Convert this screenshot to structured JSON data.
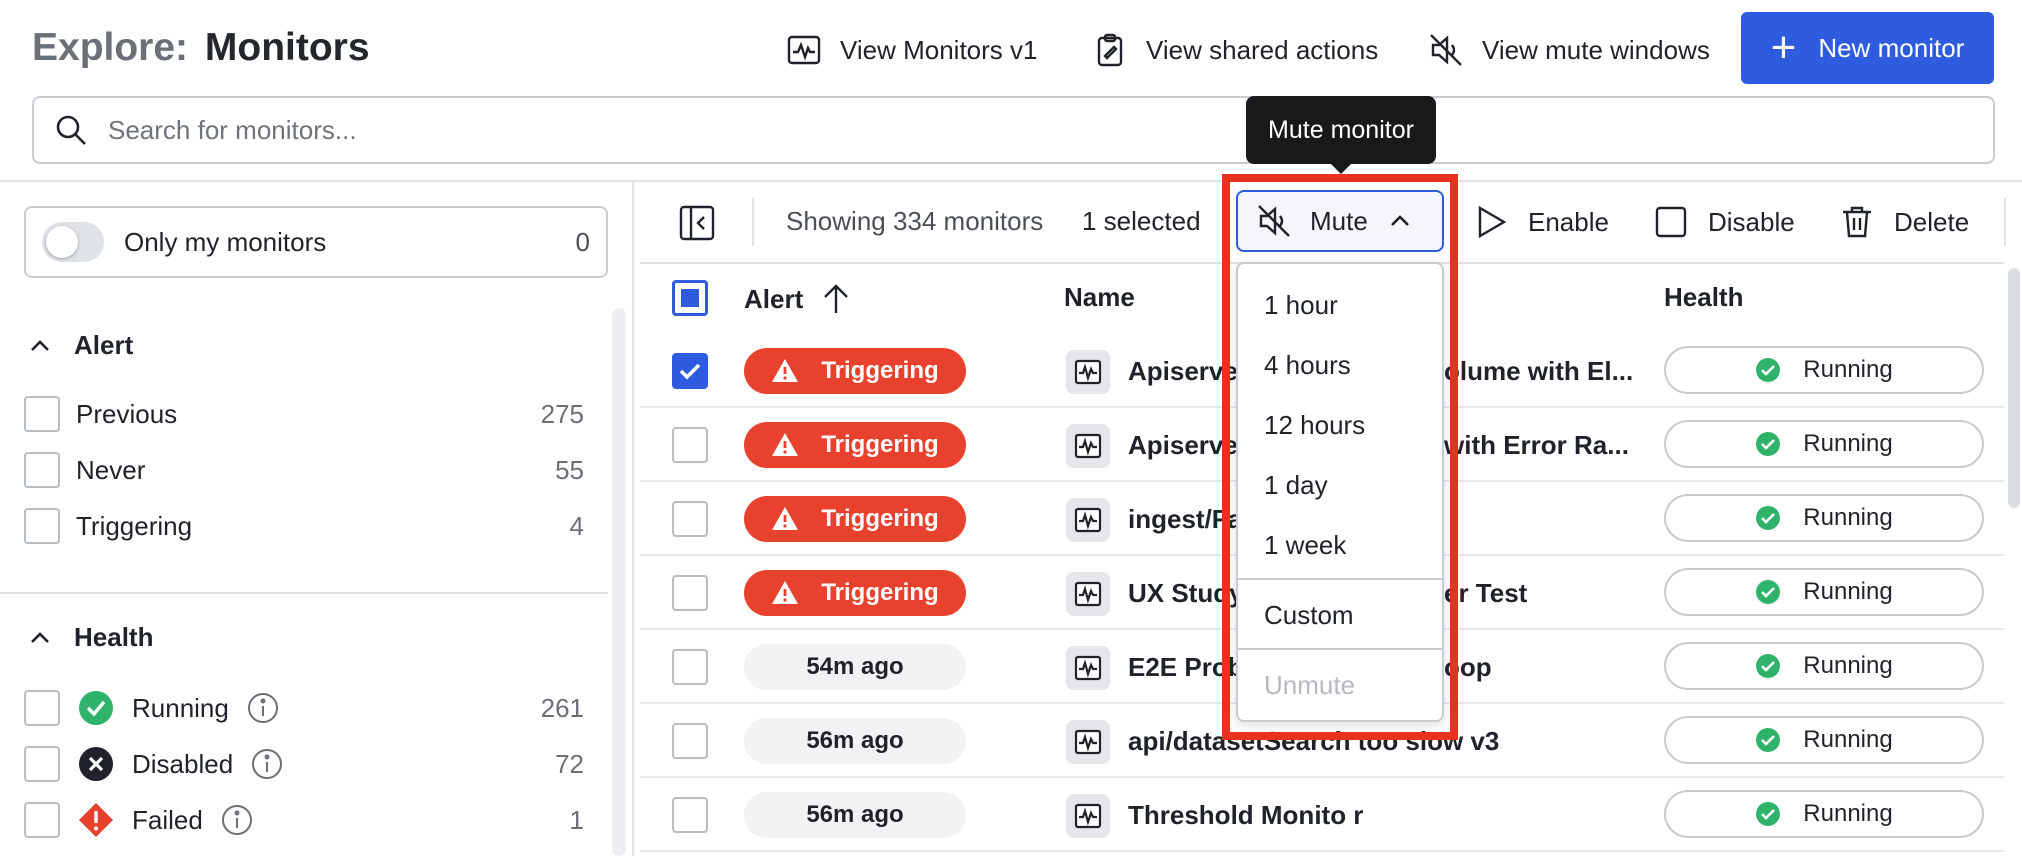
{
  "header": {
    "title_prefix": "Explore:",
    "title": "Monitors",
    "view_v1": "View Monitors v1",
    "view_shared": "View shared actions",
    "view_mute": "View mute windows",
    "new_monitor": "New monitor"
  },
  "search": {
    "placeholder": "Search for monitors..."
  },
  "sidebar": {
    "toggle_label": "Only my monitors",
    "toggle_count": "0",
    "alert_section": "Alert",
    "alert_filters": [
      {
        "label": "Previous",
        "count": "275"
      },
      {
        "label": "Never",
        "count": "55"
      },
      {
        "label": "Triggering",
        "count": "4"
      }
    ],
    "health_section": "Health",
    "health_filters": [
      {
        "label": "Running",
        "count": "261"
      },
      {
        "label": "Disabled",
        "count": "72"
      },
      {
        "label": "Failed",
        "count": "1"
      }
    ]
  },
  "toolbar": {
    "showing": "Showing 334 monitors",
    "selected": "1 selected",
    "mute": "Mute",
    "enable": "Enable",
    "disable": "Disable",
    "delete": "Delete"
  },
  "tooltip": "Mute monitor",
  "mute_menu": {
    "items": [
      "1 hour",
      "4 hours",
      "12 hours",
      "1 day",
      "1 week"
    ],
    "custom": "Custom",
    "unmute": "Unmute"
  },
  "table": {
    "headers": {
      "alert": "Alert",
      "name": "Name",
      "health": "Health"
    },
    "rows": [
      {
        "alert": "Triggering",
        "name_left": "Apiserve",
        "name_right": "olume with El...",
        "health": "Running",
        "checked": true
      },
      {
        "alert": "Triggering",
        "name_left": "Apiserve",
        "name_right": "with Error Ra...",
        "health": "Running"
      },
      {
        "alert": "Triggering",
        "name_left": "ingest/Fa",
        "name_right": "",
        "health": "Running"
      },
      {
        "alert": "Triggering",
        "name_left": "UX Study",
        "name_right": "er Test",
        "health": "Running"
      },
      {
        "alert": "54m ago",
        "name_left": "E2E Prob",
        "name_right": "oop",
        "health": "Running"
      },
      {
        "alert": "56m ago",
        "name_left": "api/datasetSearch too slow v3",
        "name_right": "",
        "health": "Running"
      },
      {
        "alert": "56m ago",
        "name_left": "Threshold Monito r",
        "name_right": "",
        "health": "Running"
      }
    ]
  },
  "colors": {
    "accent": "#2f5bde",
    "triggering": "#e8412e",
    "running": "#2fb36b",
    "highlight": "#e8321f"
  }
}
